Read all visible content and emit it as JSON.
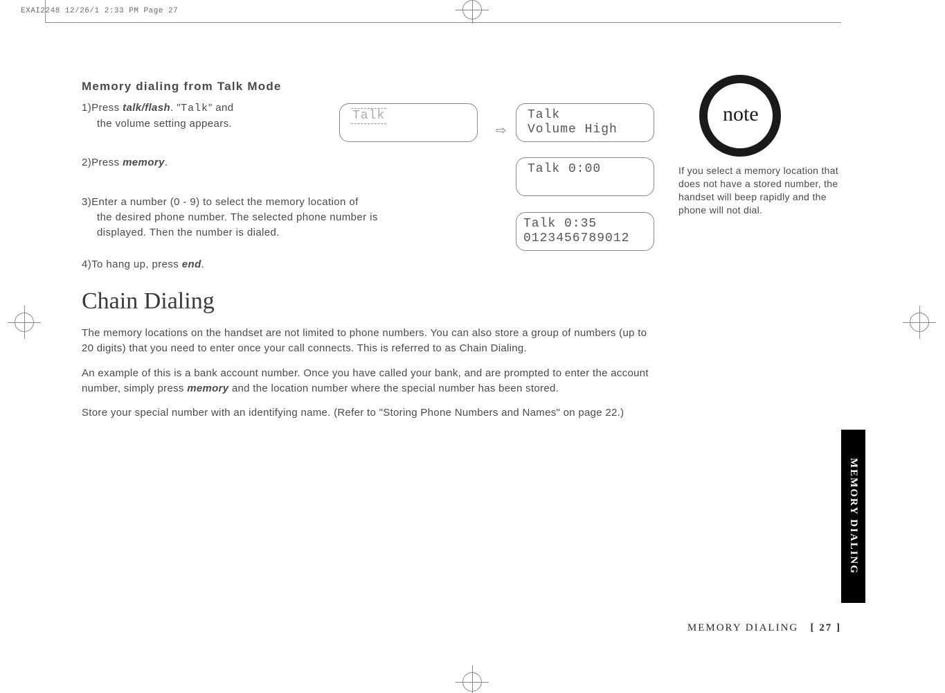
{
  "header": {
    "slug": "EXAI2248  12/26/1 2:33 PM  Page 27"
  },
  "content": {
    "section_title": "Memory dialing from Talk Mode",
    "step1_pre": "1)Press ",
    "step1_key": "talk/flash",
    "step1_post_a": ". \"",
    "step1_mono": "Talk",
    "step1_post_b": "\" and",
    "step1_line2": "the volume setting appears.",
    "step2_pre": "2)Press ",
    "step2_key": "memory",
    "step2_post": ".",
    "step3_line1": "3)Enter a number (0 - 9) to select the memory location of",
    "step3_line2": "the desired phone number. The selected phone number is",
    "step3_line3": "displayed. Then the number is dialed.",
    "step4_pre": "4)To hang up, press ",
    "step4_key": "end",
    "step4_post": ".",
    "main_heading": "Chain Dialing",
    "para1": "The memory locations on the handset are not limited to phone numbers. You can also store a group of numbers (up to 20 digits) that you need to enter once your call connects. This is referred to as Chain Dialing.",
    "para2_a": "An example of this is a bank account number. Once you have called your bank, and are prompted to enter the account number, simply press ",
    "para2_key": "memory",
    "para2_b": " and the location number where the special number has been stored.",
    "para3": "Store your special number with an identifying name. (Refer to \"Storing Phone Numbers and Names\" on page 22.)"
  },
  "lcd": {
    "box1": " Talk",
    "box2_l1": " Talk",
    "box2_l2": " Volume High",
    "box3": "  Talk   0:00",
    "box4_l1": "  Talk   0:35",
    "box4_l2": "0123456789012"
  },
  "note": {
    "label": "note",
    "text": "If you select a memory location that does not have a stored number, the handset will beep rapidly and the phone will not dial."
  },
  "sidebar": {
    "tab": "MEMORY DIALING"
  },
  "footer": {
    "section": "MEMORY DIALING",
    "page_open": "[ ",
    "page_num": "27",
    "page_close": " ]"
  }
}
